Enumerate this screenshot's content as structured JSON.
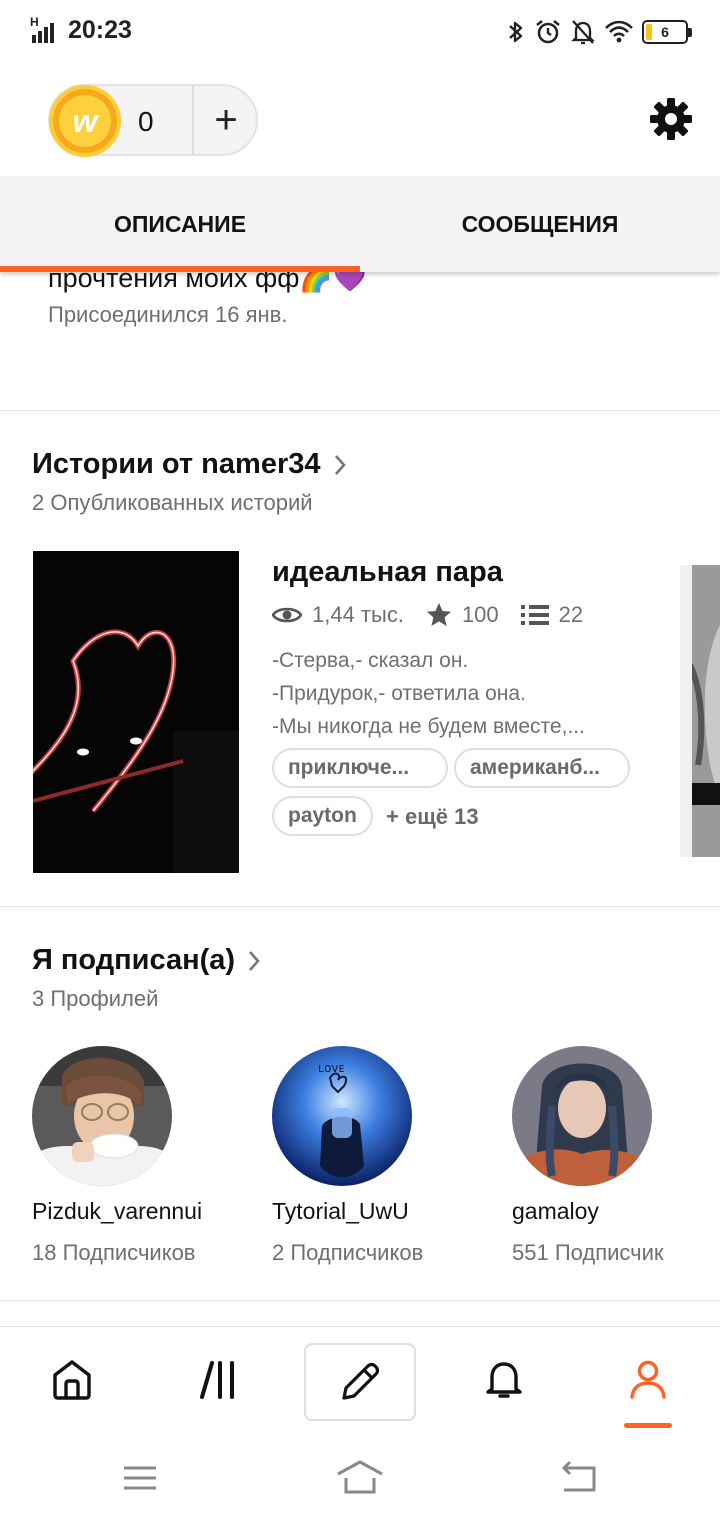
{
  "status_bar": {
    "network": "H",
    "time": "20:23",
    "battery": "6"
  },
  "header": {
    "coins": "0",
    "coin_symbol": "w",
    "add_label": "+"
  },
  "tabs": [
    {
      "label": "ОПИСАНИЕ",
      "active": true
    },
    {
      "label": "СООБЩЕНИЯ",
      "active": false
    }
  ],
  "profile": {
    "description_tail": "прочтения моих фф🌈💜",
    "joined": "Присоединился 16 янв."
  },
  "stories_section": {
    "title": "Истории от namer34",
    "subtitle": "2 Опубликованных историй",
    "story": {
      "title": "идеальная пара",
      "reads": "1,44 тыс.",
      "votes": "100",
      "parts": "22",
      "blurb": [
        "-Стерва,- сказал он.",
        "-Придурок,- ответила она.",
        "-Мы никогда не будем вместе,..."
      ],
      "tags": [
        "приключе...",
        "американб...",
        "payton"
      ],
      "more_tags": "+ ещё 13"
    }
  },
  "following_section": {
    "title": "Я подписан(а)",
    "subtitle": "3 Профилей",
    "profiles": [
      {
        "name": "Pizduk_varennui",
        "followers": "18 Подписчиков"
      },
      {
        "name": "Tytorial_UwU",
        "followers": "2 Подписчиков"
      },
      {
        "name": "gamaloy",
        "followers": "551 Подписчик"
      }
    ]
  },
  "bottom_nav": {
    "items": [
      "home-icon",
      "library-icon",
      "write-icon",
      "notifications-icon",
      "profile-icon"
    ],
    "active": "profile-icon"
  },
  "colors": {
    "accent": "#ff6122",
    "coin": "#f8a91a",
    "text": "#121212",
    "muted": "#6f6f6f"
  }
}
